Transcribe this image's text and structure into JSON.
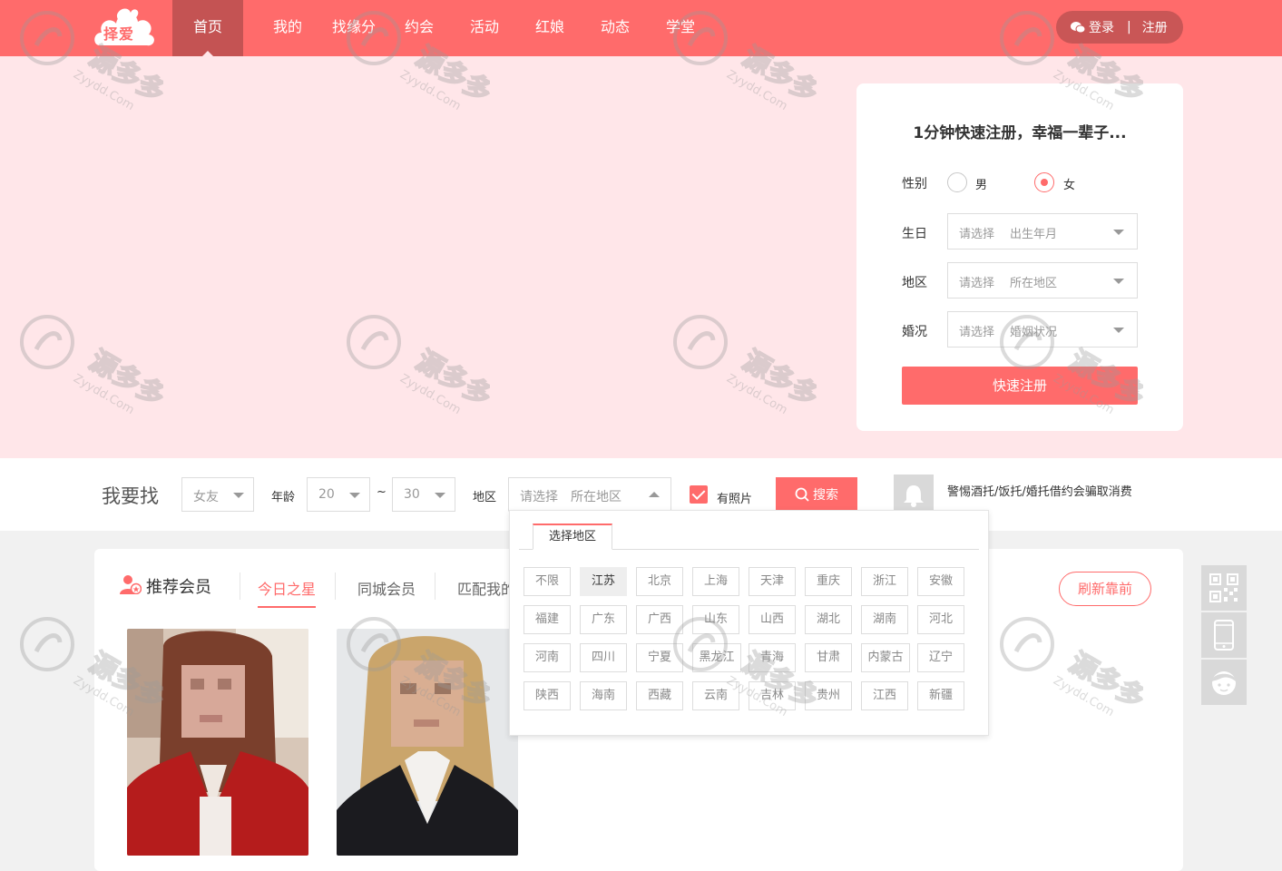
{
  "header": {
    "logo_text": "择爱",
    "nav": [
      {
        "label": "首页",
        "active": true
      },
      {
        "label": "我的",
        "active": false
      },
      {
        "label": "找缘分",
        "active": false
      },
      {
        "label": "约会",
        "active": false
      },
      {
        "label": "活动",
        "active": false
      },
      {
        "label": "红娘",
        "active": false
      },
      {
        "label": "动态",
        "active": false
      },
      {
        "label": "学堂",
        "active": false
      }
    ],
    "login_label": "登录",
    "separator": "|",
    "register_label": "注册"
  },
  "register_card": {
    "title": "1分钟快速注册，幸福一辈子...",
    "gender_label": "性别",
    "gender_options": [
      "男",
      "女"
    ],
    "gender_selected": "女",
    "birthday_label": "生日",
    "birthday_prefix": "请选择",
    "birthday_value": "出生年月",
    "region_label": "地区",
    "region_prefix": "请选择",
    "region_value": "所在地区",
    "marriage_label": "婚况",
    "marriage_prefix": "请选择",
    "marriage_value": "婚姻状况",
    "submit_label": "快速注册"
  },
  "search": {
    "title": "我要找",
    "target_value": "女友",
    "age_label": "年龄",
    "age_min": "20",
    "age_sep": "~",
    "age_max": "30",
    "region_label": "地区",
    "region_prefix": "请选择",
    "region_value": "所在地区",
    "photo_label": "有照片",
    "photo_checked": true,
    "button_label": "搜索",
    "notice": "警惕酒托/饭托/婚托借约会骗取消费"
  },
  "region_dropdown": {
    "tab_label": "选择地区",
    "selected": "江苏",
    "rows": [
      [
        "不限",
        "江苏",
        "北京",
        "上海",
        "天津",
        "重庆",
        "浙江",
        "安徽"
      ],
      [
        "福建",
        "广东",
        "广西",
        "山东",
        "山西",
        "湖北",
        "湖南",
        "河北"
      ],
      [
        "河南",
        "四川",
        "宁夏",
        "黑龙江",
        "青海",
        "甘肃",
        "内蒙古",
        "辽宁"
      ],
      [
        "陕西",
        "海南",
        "西藏",
        "云南",
        "吉林",
        "贵州",
        "江西",
        "新疆"
      ]
    ]
  },
  "recommend": {
    "title": "推荐会员",
    "tabs": [
      {
        "label": "今日之星",
        "active": true
      },
      {
        "label": "同城会员",
        "active": false
      },
      {
        "label": "匹配我的",
        "active": false
      }
    ],
    "refresh_label": "刷新靠前"
  },
  "watermark": {
    "text": "源多多",
    "sub": "Zyydd.Com"
  },
  "colors": {
    "brand": "#ff6b6b",
    "nav_active": "#c45353",
    "hero_bg": "#ffe6e9"
  },
  "icons": [
    "wechat-icon",
    "bell-icon",
    "search-icon",
    "qrcode-icon",
    "phone-icon",
    "customer-service-icon",
    "member-icon"
  ]
}
